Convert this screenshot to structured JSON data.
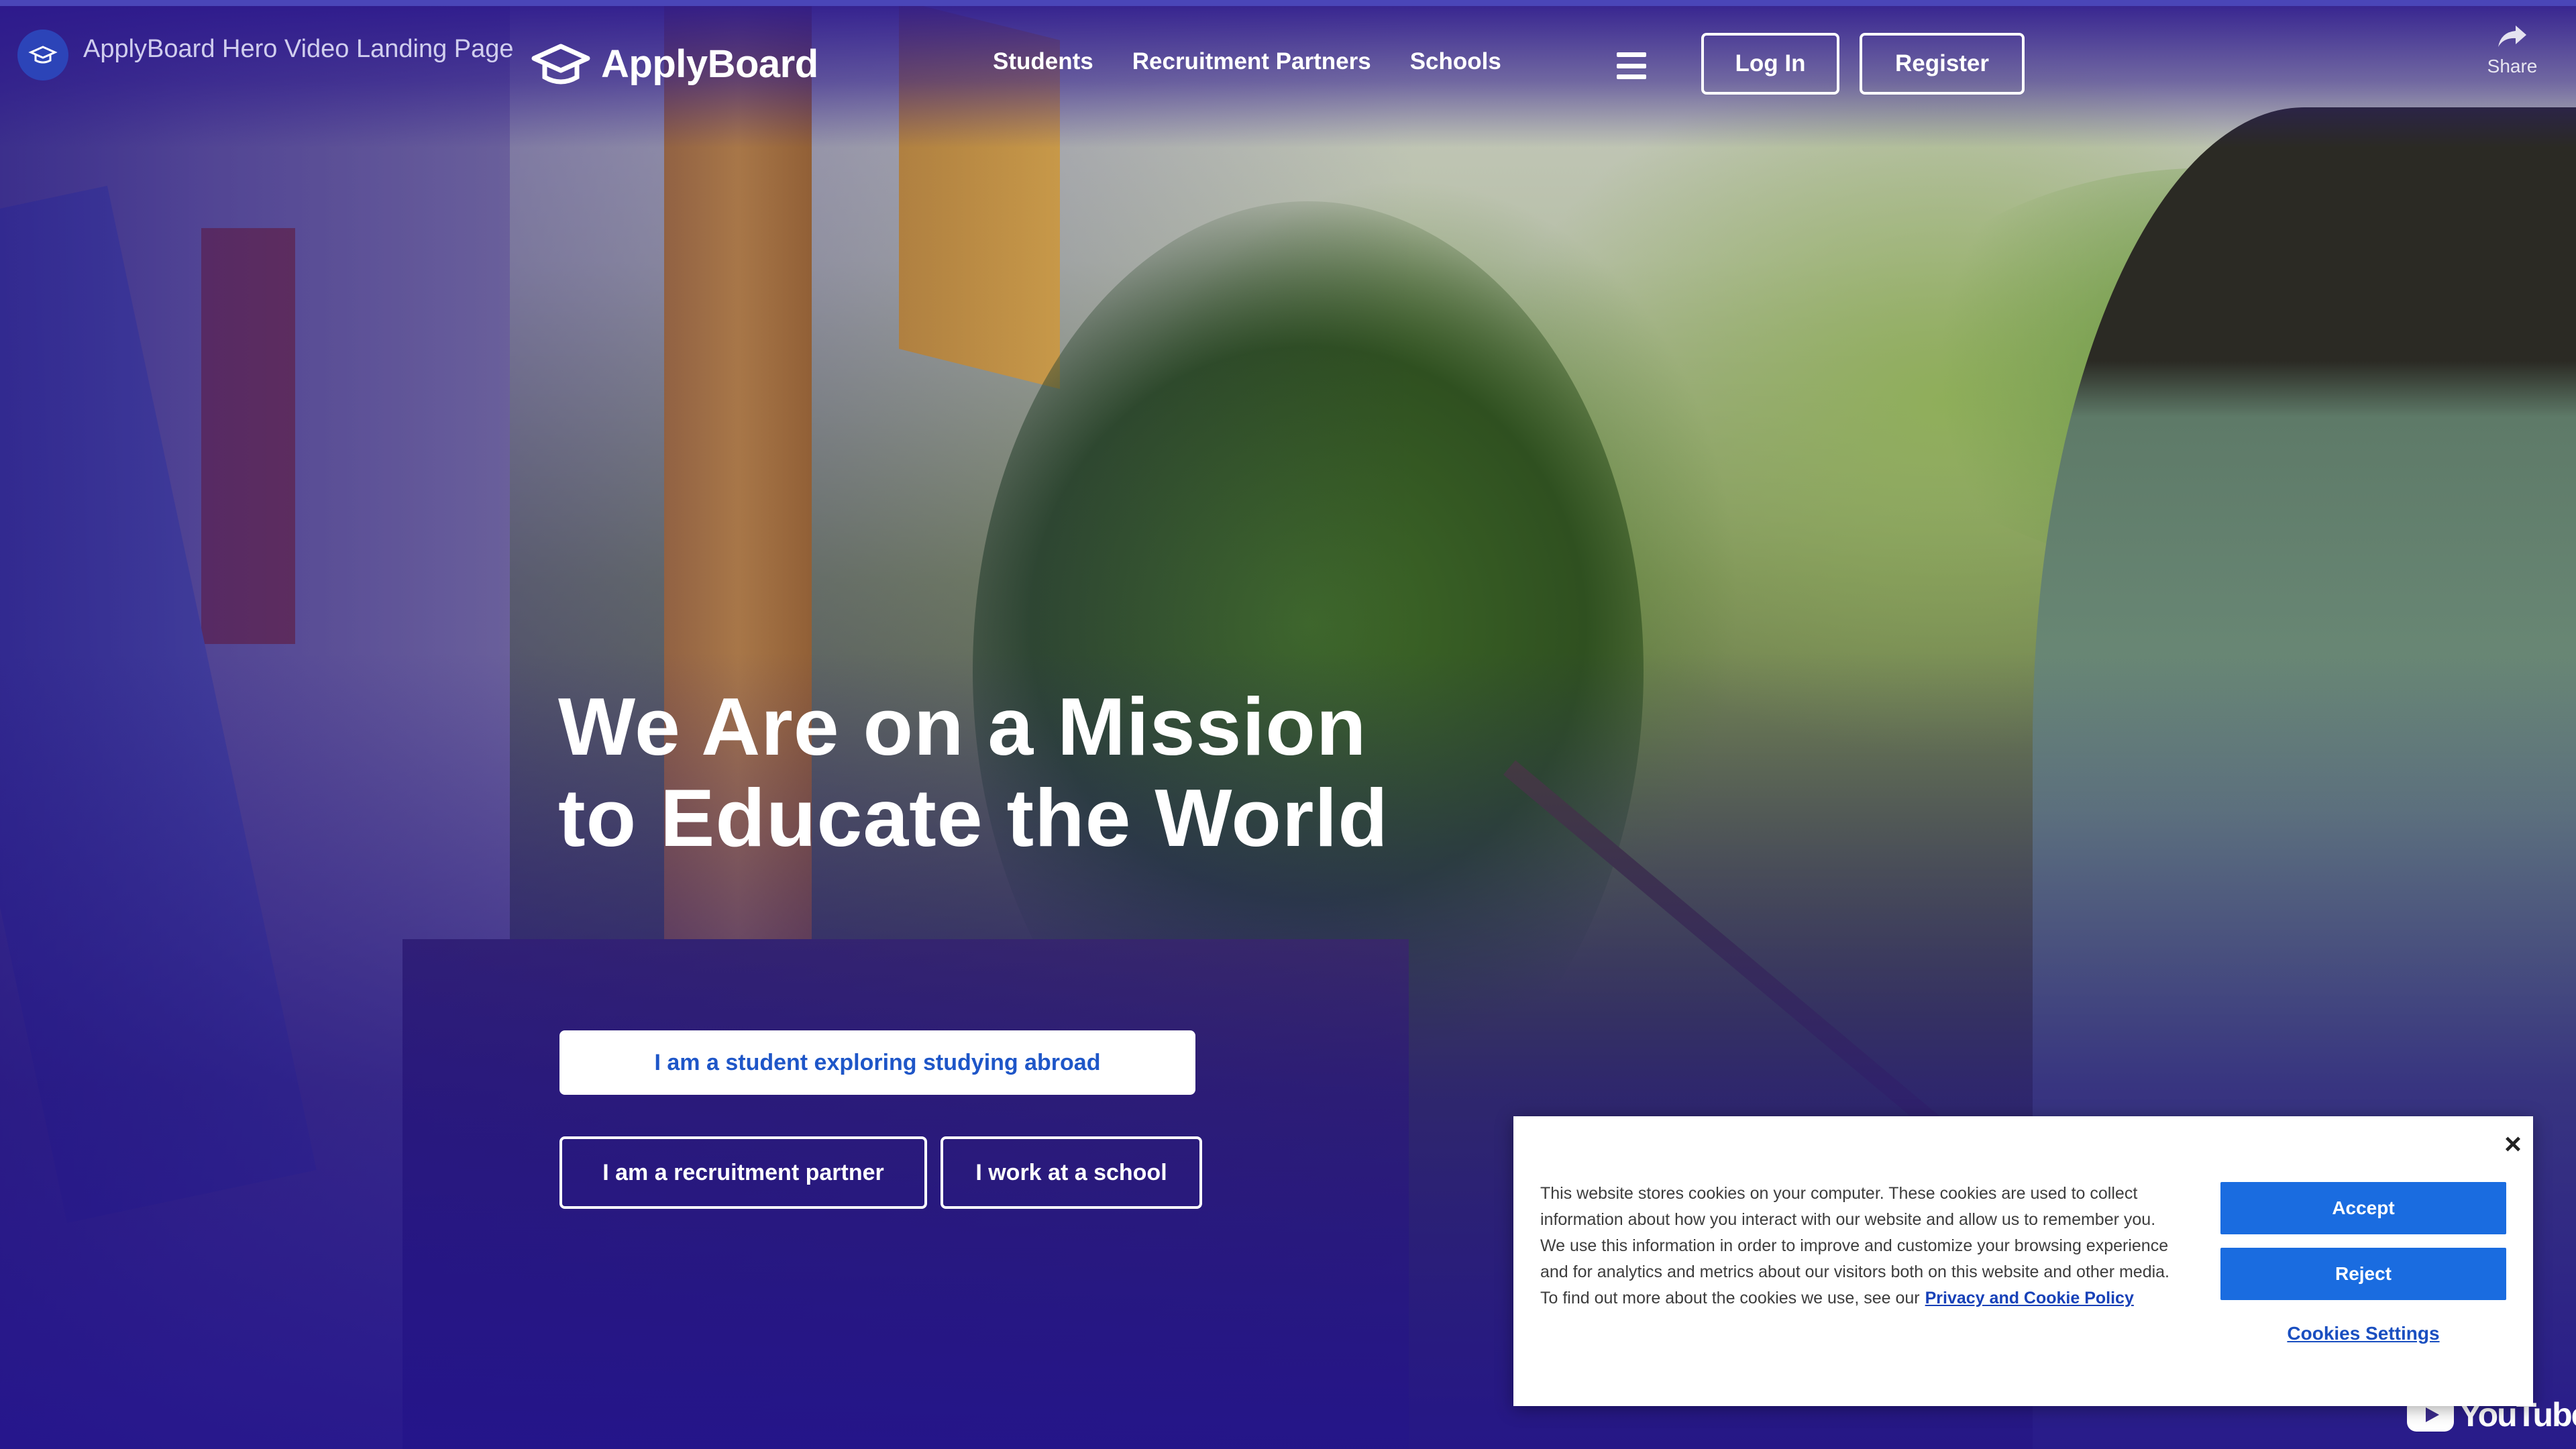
{
  "youtube": {
    "video_title": "ApplyBoard Hero Video Landing Page",
    "share_label": "Share",
    "logo_text": "YouTube"
  },
  "nav": {
    "brand": "ApplyBoard",
    "links": [
      "Students",
      "Recruitment Partners",
      "Schools"
    ],
    "login_label": "Log In",
    "register_label": "Register"
  },
  "hero": {
    "headline": "We Are on a Mission to Educate the World",
    "cta_student": "I am a student exploring studying abroad",
    "cta_partner": "I am a recruitment partner",
    "cta_school": "I work at a school"
  },
  "cookie_banner": {
    "text": "This website stores cookies on your computer. These cookies are used to collect information about how you interact with our website and allow us to remember you. We use this information in order to improve and customize your browsing experience and for analytics and metrics about our visitors both on this website and other media. To find out more about the cookies we use, see our",
    "policy_link": "Privacy and Cookie Policy",
    "accept_label": "Accept",
    "reject_label": "Reject",
    "settings_label": "Cookies Settings",
    "close_icon": "close-icon"
  },
  "colors": {
    "brand_overlay": "#2c188c",
    "primary_button": "#1a6ce0",
    "link": "#1741b8"
  }
}
